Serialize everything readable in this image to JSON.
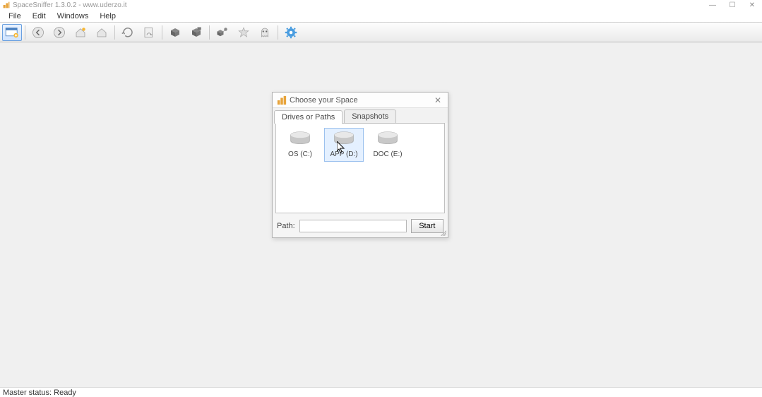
{
  "window": {
    "title": "SpaceSniffer 1.3.0.2 - www.uderzo.it",
    "controls": {
      "min": "—",
      "max": "☐",
      "close": "✕"
    }
  },
  "menu": {
    "items": [
      "File",
      "Edit",
      "Windows",
      "Help"
    ]
  },
  "toolbar": {
    "buttons": [
      {
        "name": "new-scan",
        "icon": "new-scan-icon"
      },
      {
        "name": "back",
        "icon": "back-icon"
      },
      {
        "name": "forward",
        "icon": "forward-icon"
      },
      {
        "name": "home-pin",
        "icon": "home-pin-icon"
      },
      {
        "name": "home",
        "icon": "home-icon"
      },
      {
        "name": "refresh",
        "icon": "refresh-icon"
      },
      {
        "name": "reload",
        "icon": "reload-icon"
      },
      {
        "name": "box1",
        "icon": "box-icon"
      },
      {
        "name": "box2",
        "icon": "box-stack-icon"
      },
      {
        "name": "box3",
        "icon": "box-link-icon"
      },
      {
        "name": "favorite",
        "icon": "star-icon"
      },
      {
        "name": "ghost",
        "icon": "ghost-icon"
      },
      {
        "name": "settings",
        "icon": "gear-icon"
      }
    ]
  },
  "dialog": {
    "title": "Choose your Space",
    "tabs": [
      "Drives or Paths",
      "Snapshots"
    ],
    "active_tab": 0,
    "drives": [
      {
        "label": "OS (C:)"
      },
      {
        "label": "APP (D:)"
      },
      {
        "label": "DOC (E:)"
      }
    ],
    "selected_drive": 1,
    "path_label": "Path:",
    "path_value": "",
    "start_label": "Start"
  },
  "status": {
    "text": "Master status: Ready"
  }
}
